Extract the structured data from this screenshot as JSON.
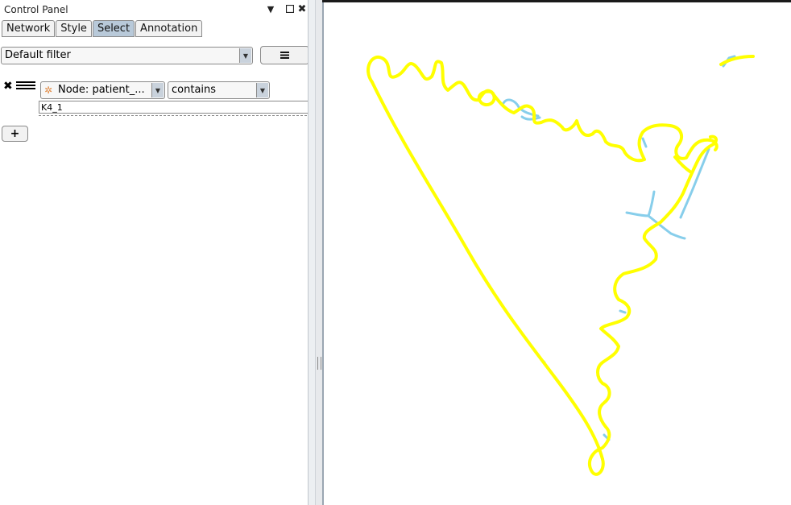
{
  "control_panel": {
    "title": "Control Panel",
    "tabs": [
      {
        "label": "Network",
        "active": false
      },
      {
        "label": "Style",
        "active": false
      },
      {
        "label": "Select",
        "active": true
      },
      {
        "label": "Annotation",
        "active": false
      }
    ],
    "filter_combo": {
      "value": "Default filter"
    },
    "condition": {
      "column_combo": {
        "value": "Node: patient_..."
      },
      "operator_combo": {
        "value": "contains"
      },
      "value_input": "K4_1"
    }
  },
  "icons": {
    "minimize": "triangle-down-icon",
    "float": "window-square-icon",
    "close": "close-icon",
    "menu": "hamburger-menu-icon",
    "remove": "close-icon",
    "drag": "drag-handle-icon",
    "node": "node-icon",
    "add": "plus-icon"
  },
  "colors": {
    "edge_yellow": "#ffff00",
    "edge_blue": "#87ceeb",
    "active_tab": "#b8c9d9"
  }
}
